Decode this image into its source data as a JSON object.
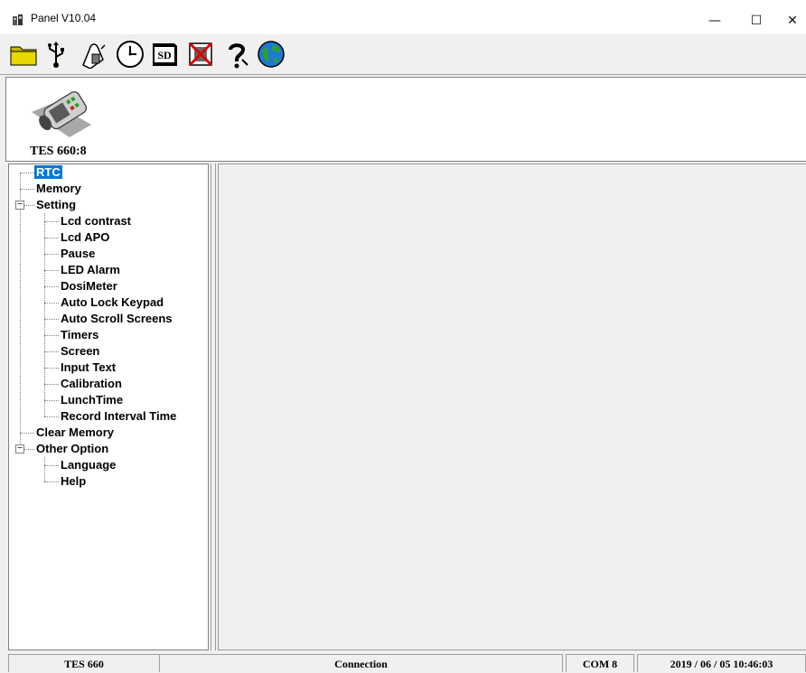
{
  "window": {
    "title": "Panel V10.04",
    "controls": {
      "minimize": "—",
      "maximize": "☐",
      "close": "✕"
    }
  },
  "toolbar": {
    "buttons": [
      {
        "name": "open-folder",
        "icon": "folder-icon"
      },
      {
        "name": "usb",
        "icon": "usb-icon"
      },
      {
        "name": "device-connect",
        "icon": "hand-device-icon"
      },
      {
        "name": "clock",
        "icon": "clock-icon"
      },
      {
        "name": "sd-card",
        "icon": "sd-card-icon",
        "label": "SD"
      },
      {
        "name": "disconnect",
        "icon": "device-crossed-icon"
      },
      {
        "name": "help",
        "icon": "question-icon"
      },
      {
        "name": "web",
        "icon": "globe-icon"
      }
    ]
  },
  "device": {
    "name": "TES 660:8"
  },
  "tree": {
    "rtc": "RTC",
    "memory": "Memory",
    "setting": {
      "label": "Setting",
      "expander": "−",
      "children": [
        "Lcd contrast",
        "Lcd APO",
        "Pause",
        "LED Alarm",
        "DosiMeter",
        "Auto Lock Keypad",
        "Auto Scroll Screens",
        "Timers",
        "Screen",
        "Input Text",
        "Calibration",
        "LunchTime",
        "Record Interval Time"
      ]
    },
    "clear_memory": "Clear Memory",
    "other_option": {
      "label": "Other Option",
      "expander": "−",
      "children": [
        "Language",
        "Help"
      ]
    }
  },
  "statusbar": {
    "model": "TES 660",
    "connection": "Connection",
    "port": "COM 8",
    "datetime": "2019 / 06 / 05  10:46:03"
  },
  "colors": {
    "selection": "#0078d7",
    "background": "#f0f0f0"
  }
}
